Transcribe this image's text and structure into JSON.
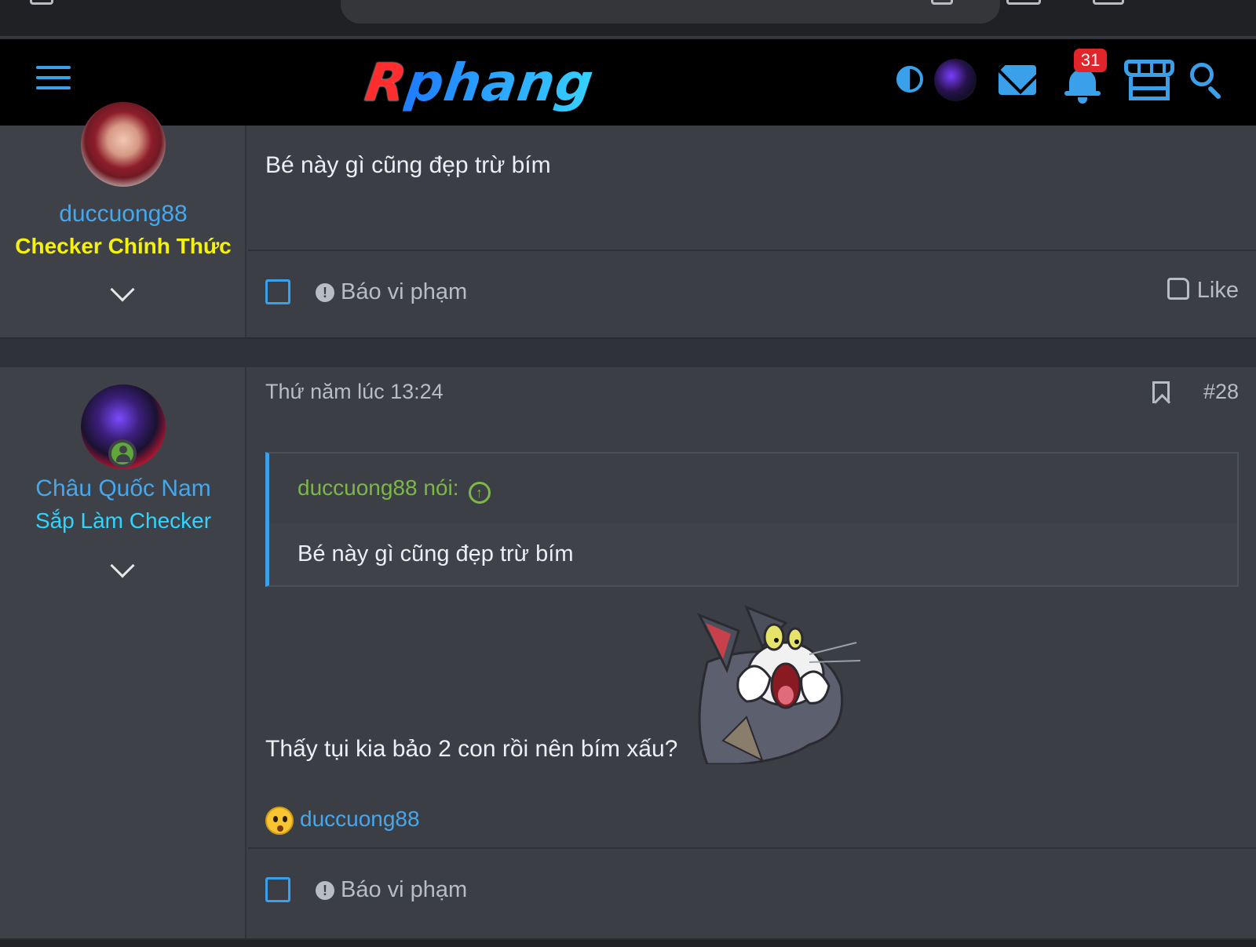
{
  "header": {
    "logo_part1": "R",
    "logo_part2": "phang",
    "notification_count": "31",
    "icons": [
      "menu-icon",
      "contrast-icon",
      "avatar",
      "mail-icon",
      "bell-icon",
      "store-icon",
      "search-icon"
    ],
    "accent_color": "#3aa0ea"
  },
  "posts": [
    {
      "username": "duccuong88",
      "user_title": "Checker Chính Thức",
      "message": "Bé này gì cũng đẹp trừ bím",
      "report_label": "Báo vi phạm",
      "like_label": "Like"
    },
    {
      "username": "Châu Quốc Nam",
      "user_title": "Sắp Làm Checker",
      "date": "Thứ năm lúc 13:24",
      "post_number": "#28",
      "quote": {
        "author": "duccuong88 nói:",
        "text": "Bé này gì cũng đẹp trừ bím"
      },
      "message": "Thấy tụi kia bảo 2 con rồi nên bím xấu?",
      "reaction_user": "duccuong88",
      "report_label": "Báo vi phạm"
    }
  ]
}
